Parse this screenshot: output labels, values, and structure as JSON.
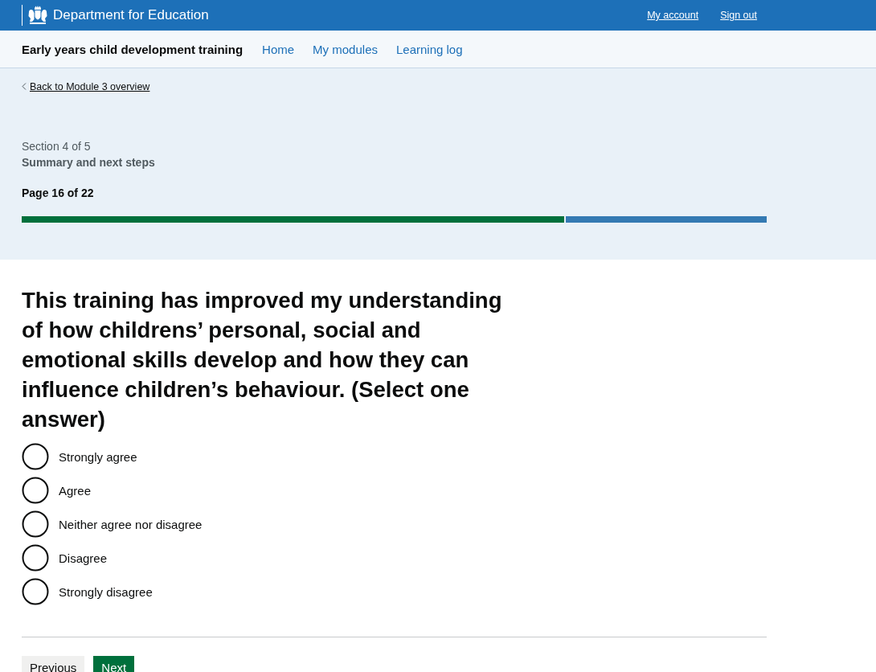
{
  "header": {
    "organisation": "Department for Education",
    "links": [
      "My account",
      "Sign out"
    ]
  },
  "service_nav": {
    "service_name": "Early years child development training",
    "links": [
      "Home",
      "My modules",
      "Learning log"
    ]
  },
  "back_link": "Back to Module 3 overview",
  "progress": {
    "section": "Section 4 of 5",
    "section_title": "Summary and next steps",
    "page": "Page 16 of 22",
    "level": 0.73
  },
  "question": {
    "heading": "This training has improved my understanding of how childrens’ personal, social and emotional skills develop and how they can influence children’s behaviour. (Select one answer)",
    "options": [
      {
        "label": "Strongly agree",
        "selected": false
      },
      {
        "label": "Agree",
        "selected": false
      },
      {
        "label": "Neither agree nor disagree",
        "selected": false
      },
      {
        "label": "Disagree",
        "selected": false
      },
      {
        "label": "Strongly disagree",
        "selected": false
      }
    ]
  },
  "buttons": [
    {
      "label": "Previous",
      "kind": "secondary"
    },
    {
      "label": "Next",
      "kind": "primary"
    }
  ]
}
